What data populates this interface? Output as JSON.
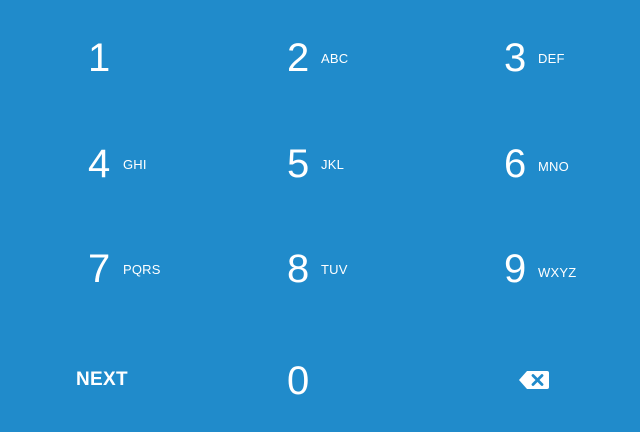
{
  "keypad": {
    "keys": [
      {
        "digit": "1",
        "letters": ""
      },
      {
        "digit": "2",
        "letters": "ABC"
      },
      {
        "digit": "3",
        "letters": "DEF"
      },
      {
        "digit": "4",
        "letters": "GHI"
      },
      {
        "digit": "5",
        "letters": "JKL"
      },
      {
        "digit": "6",
        "letters": "MNO"
      },
      {
        "digit": "7",
        "letters": "PQRS"
      },
      {
        "digit": "8",
        "letters": "TUV"
      },
      {
        "digit": "9",
        "letters": "WXYZ"
      },
      {
        "digit": "0",
        "letters": ""
      }
    ],
    "next_label": "NEXT",
    "backspace_icon": "backspace-icon"
  },
  "colors": {
    "background": "#208bcb",
    "foreground": "#ffffff"
  }
}
